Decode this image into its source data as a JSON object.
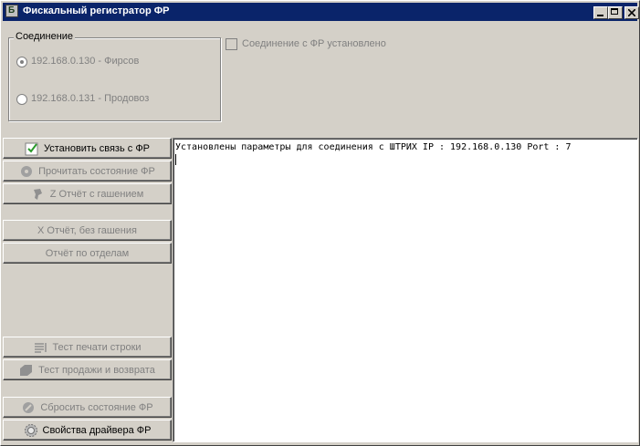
{
  "window": {
    "title": "Фискальный регистратор ФР",
    "icon": "app-icon"
  },
  "connection": {
    "group_title": "Соединение",
    "options": [
      {
        "label": "192.168.0.130 - Фирсов",
        "checked": true
      },
      {
        "label": "192.168.0.131 - Продовоз",
        "checked": false
      }
    ],
    "status_checkbox_label": "Соединение с ФР установлено",
    "status_checked": false
  },
  "buttons": {
    "connect": "Установить связь с ФР",
    "read_state": "Прочитать состояние ФР",
    "z_report": "Z Отчёт с гашением",
    "x_report": "X Отчёт, без гашения",
    "dept_report": "Отчёт по отделам",
    "print_test": "Тест печати строки",
    "sale_test": "Тест продажи и возврата",
    "reset_state": "Сбросить состояние ФР",
    "driver_props": "Свойства драйвера ФР"
  },
  "log": {
    "lines": [
      "Установлены параметры для соединения с ШТРИХ IP : 192.168.0.130 Port : 7"
    ]
  }
}
